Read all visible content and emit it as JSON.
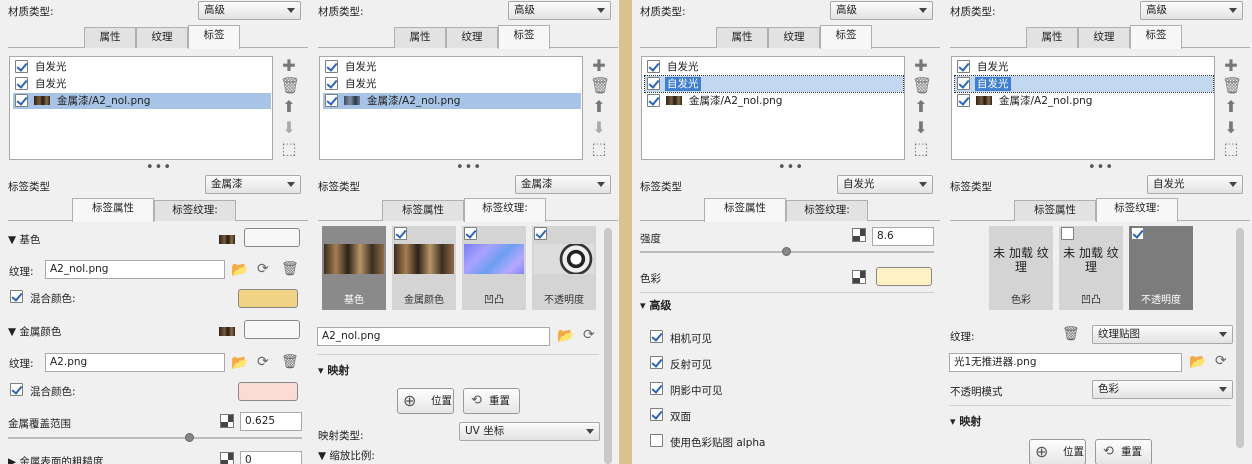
{
  "colors": {
    "accent": "#3f7fcd",
    "sel_row": "#a7c4e6",
    "divider": "#d9c28e",
    "swatch_yellow": "#f1d385",
    "swatch_pink": "#f8dcd5",
    "swatch_cream": "#fff2c4"
  },
  "p1": {
    "mat_type_label": "材质类型:",
    "mat_type_value": "高级",
    "tabs": [
      "属性",
      "纹理",
      "标签"
    ],
    "list": [
      "自发光",
      "自发光",
      "金属漆/A2_nol.png"
    ],
    "tag_type_label": "标签类型",
    "tag_type_value": "金属漆",
    "subtabs": [
      "标签属性",
      "标签纹理:"
    ],
    "base_header": "▼ 基色",
    "tex_label": "纹理:",
    "tex1": "A2_nol.png",
    "mix_label": "混合颜色:",
    "metal_header": "▼ 金属颜色",
    "tex2": "A2.png",
    "mix2_label": "混合颜色:",
    "coverage_label": "金属覆盖范围",
    "coverage_value": "0.625",
    "rough_label": "▶ 金属表面的粗糙度",
    "rough_value": "0"
  },
  "p2": {
    "mat_type_label": "材质类型:",
    "mat_type_value": "高级",
    "tabs": [
      "属性",
      "纹理",
      "标签"
    ],
    "list": [
      "自发光",
      "自发光",
      "金属漆/A2_nol.png"
    ],
    "tag_type_label": "标签类型",
    "tag_type_value": "金属漆",
    "subtabs": [
      "标签属性",
      "标签纹理:"
    ],
    "cards": [
      "基色",
      "金属颜色",
      "凹凸",
      "不透明度"
    ],
    "file": "A2_nol.png",
    "map_header": "映射",
    "pos_btn": "位置",
    "reset_btn": "重置",
    "map_type_label": "映射类型:",
    "map_type_value": "UV 坐标",
    "scale_label": "▼ 缩放比例:"
  },
  "p3": {
    "mat_type_label": "材质类型:",
    "mat_type_value": "高级",
    "tabs": [
      "属性",
      "纹理",
      "标签"
    ],
    "list": [
      "自发光",
      "自发光",
      "金属漆/A2_nol.png"
    ],
    "tag_type_label": "标签类型",
    "tag_type_value": "自发光",
    "subtabs": [
      "标签属性",
      "标签纹理:"
    ],
    "strength_label": "强度",
    "strength_value": "8.6",
    "color_label": "色彩",
    "adv_header": "高级",
    "checks": [
      "相机可见",
      "反射可见",
      "阴影中可见",
      "双面",
      "使用色彩贴图 alpha"
    ]
  },
  "p4": {
    "mat_type_label": "材质类型:",
    "mat_type_value": "高级",
    "tabs": [
      "属性",
      "纹理",
      "标签"
    ],
    "list": [
      "自发光",
      "自发光",
      "金属漆/A2_nol.png"
    ],
    "tag_type_label": "标签类型",
    "tag_type_value": "自发光",
    "subtabs": [
      "标签属性",
      "标签纹理:"
    ],
    "card1": "未 加载 纹理",
    "card1_cap": "色彩",
    "card2": "未 加载 纹理",
    "card2_cap": "凹凸",
    "card3_cap": "不透明度",
    "tex_label": "纹理:",
    "tex_type_value": "纹理贴图",
    "file": "光1无推进器.png",
    "opacity_label": "不透明模式",
    "opacity_value": "色彩",
    "map_header": "映射",
    "pos_btn": "位置",
    "reset_btn": "重置"
  }
}
